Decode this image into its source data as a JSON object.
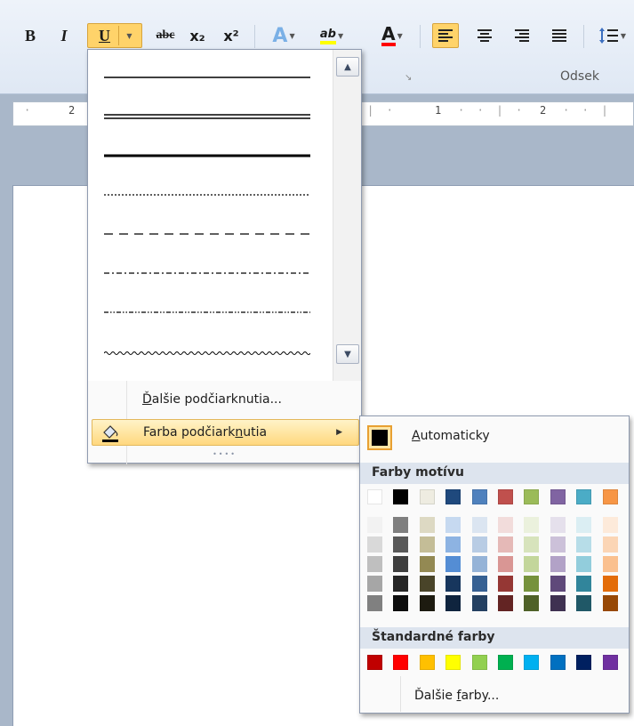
{
  "toolbar": {
    "bold": "B",
    "italic": "I",
    "underline": "U",
    "strike": "abc",
    "subscript": "x₂",
    "superscript": "x²",
    "text_effects": "A",
    "highlight": "ab",
    "font_color": "A",
    "group_label": "Odsek"
  },
  "ruler": {
    "ticks": [
      "2",
      "1",
      "2"
    ]
  },
  "underline_menu": {
    "line_styles": [
      "single",
      "double",
      "thick",
      "dotted",
      "dashed",
      "dash-dot",
      "dash-dot-dot",
      "wave"
    ],
    "more_underlines": {
      "pre": "",
      "acc": "Ď",
      "post": "alšie podčiarknutia..."
    },
    "underline_color": {
      "pre": "Farba podčiark",
      "acc": "n",
      "post": "utia"
    }
  },
  "color_menu": {
    "automatic": {
      "pre": "",
      "acc": "A",
      "post": "utomaticky"
    },
    "theme_header": "Farby motívu",
    "standard_header": "Štandardné farby",
    "more_colors": {
      "pre": "Ďalšie ",
      "acc": "f",
      "post": "arby..."
    },
    "theme_colors": [
      "#ffffff",
      "#000000",
      "#eeece1",
      "#1f497d",
      "#4f81bd",
      "#c0504d",
      "#9bbb59",
      "#8064a2",
      "#4bacc6",
      "#f79646"
    ],
    "theme_shades": [
      [
        "#f2f2f2",
        "#d9d9d9",
        "#bfbfbf",
        "#a6a6a6",
        "#808080"
      ],
      [
        "#7f7f7f",
        "#595959",
        "#3f3f3f",
        "#262626",
        "#0d0d0d"
      ],
      [
        "#ddd9c3",
        "#c4bd97",
        "#938953",
        "#494429",
        "#1d1b10"
      ],
      [
        "#c6d9f0",
        "#8db3e2",
        "#548dd4",
        "#17365d",
        "#0f243e"
      ],
      [
        "#dbe5f1",
        "#b8cce4",
        "#95b3d7",
        "#366092",
        "#244061"
      ],
      [
        "#f2dcdb",
        "#e5b9b7",
        "#d99694",
        "#953734",
        "#632423"
      ],
      [
        "#ebf1dd",
        "#d7e3bc",
        "#c3d69b",
        "#76923c",
        "#4f6128"
      ],
      [
        "#e5e0ec",
        "#ccc1d9",
        "#b2a2c7",
        "#5f497a",
        "#3f3151"
      ],
      [
        "#dbeef3",
        "#b7dde8",
        "#92cddc",
        "#31859b",
        "#205867"
      ],
      [
        "#fdeada",
        "#fbd5b5",
        "#fac08f",
        "#e36c09",
        "#974806"
      ]
    ],
    "standard_colors": [
      "#c00000",
      "#ff0000",
      "#ffc000",
      "#ffff00",
      "#92d050",
      "#00b050",
      "#00b0f0",
      "#0070c0",
      "#002060",
      "#7030a0"
    ]
  }
}
